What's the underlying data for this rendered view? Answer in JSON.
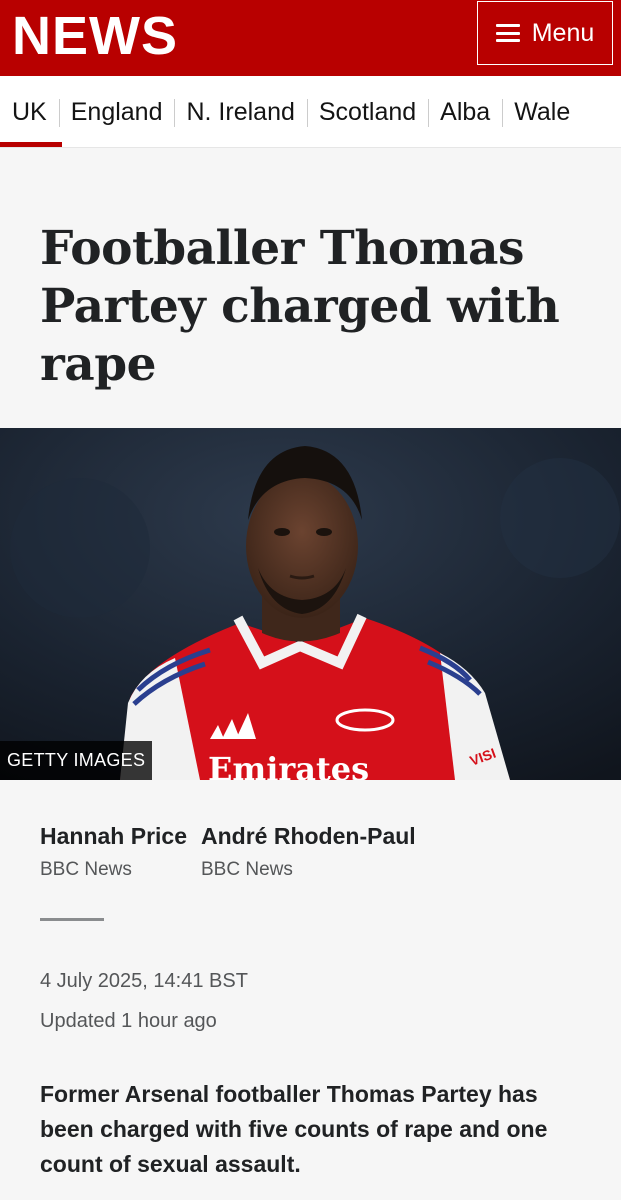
{
  "header": {
    "logo": "NEWS",
    "menu_label": "Menu"
  },
  "nav": {
    "items": [
      {
        "label": "UK"
      },
      {
        "label": "England"
      },
      {
        "label": "N. Ireland"
      },
      {
        "label": "Scotland"
      },
      {
        "label": "Alba"
      },
      {
        "label": "Wale"
      }
    ]
  },
  "article": {
    "headline": "Footballer Thomas Partey charged with rape",
    "image_credit": "GETTY IMAGES",
    "shirt_sponsor": "Emirates",
    "sleeve_text": "VISI",
    "authors": [
      {
        "name": "Hannah Price",
        "org": "BBC News"
      },
      {
        "name": "André Rhoden-Paul",
        "org": "BBC News"
      }
    ],
    "date": "4 July 2025, 14:41 BST",
    "updated": "Updated 1 hour ago",
    "summary": "Former Arsenal footballer Thomas Partey has been charged with five counts of rape and one count of sexual assault."
  },
  "colors": {
    "brand_red": "#b80000",
    "shirt_red": "#d5101a"
  }
}
